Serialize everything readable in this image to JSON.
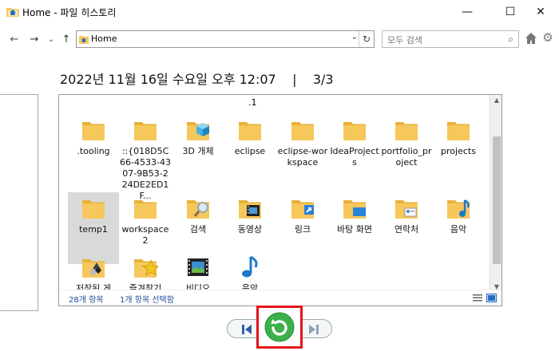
{
  "window": {
    "title": "Home - 파일 히스토리",
    "minimize": "—",
    "maximize": "☐",
    "close": "✕"
  },
  "nav": {
    "back": "←",
    "forward": "→",
    "recent": "⌄",
    "up": "↑",
    "address": "Home",
    "address_dd": "⌄",
    "refresh": "↻",
    "search_placeholder": "모두 검색",
    "search_icon": "⌕"
  },
  "date_label": "2022년 11월 16일 수요일 오후 12:07",
  "separator": "|",
  "page_indicator": "3/3",
  "top_partial_labels": [
    ".1"
  ],
  "files": [
    {
      "label": ".tooling",
      "icon": "folder"
    },
    {
      "label": "::{018D5C66-4533-4307-9B53-224DE2ED1F...",
      "icon": "folder"
    },
    {
      "label": "3D 개체",
      "icon": "folder-3d"
    },
    {
      "label": "eclipse",
      "icon": "folder"
    },
    {
      "label": "eclipse-workspace",
      "icon": "folder"
    },
    {
      "label": "IdeaProjects",
      "icon": "folder"
    },
    {
      "label": "portfolio_project",
      "icon": "folder"
    },
    {
      "label": "projects",
      "icon": "folder"
    },
    {
      "label": "temp1",
      "icon": "folder",
      "selected": true
    },
    {
      "label": "workspace2",
      "icon": "folder"
    },
    {
      "label": "검색",
      "icon": "folder-search"
    },
    {
      "label": "동영상",
      "icon": "folder-video"
    },
    {
      "label": "링크",
      "icon": "folder-link"
    },
    {
      "label": "바탕 화면",
      "icon": "folder-desktop"
    },
    {
      "label": "연락처",
      "icon": "folder-contacts"
    },
    {
      "label": "음악",
      "icon": "folder-music"
    },
    {
      "label": "저장된 게",
      "icon": "folder-games"
    },
    {
      "label": "즐겨찾기",
      "icon": "folder-favorites"
    },
    {
      "label": "비디오",
      "icon": "video-library"
    },
    {
      "label": "음악",
      "icon": "music-library"
    }
  ],
  "status": {
    "count": "28개 항목",
    "selected": "1개 항목 선택함"
  },
  "colors": {
    "folder": "#f6c85c",
    "folder_dark": "#e8b13a",
    "accent": "#1f4e9a",
    "restore_green": "#3cb04a",
    "highlight": "#e3131b"
  }
}
